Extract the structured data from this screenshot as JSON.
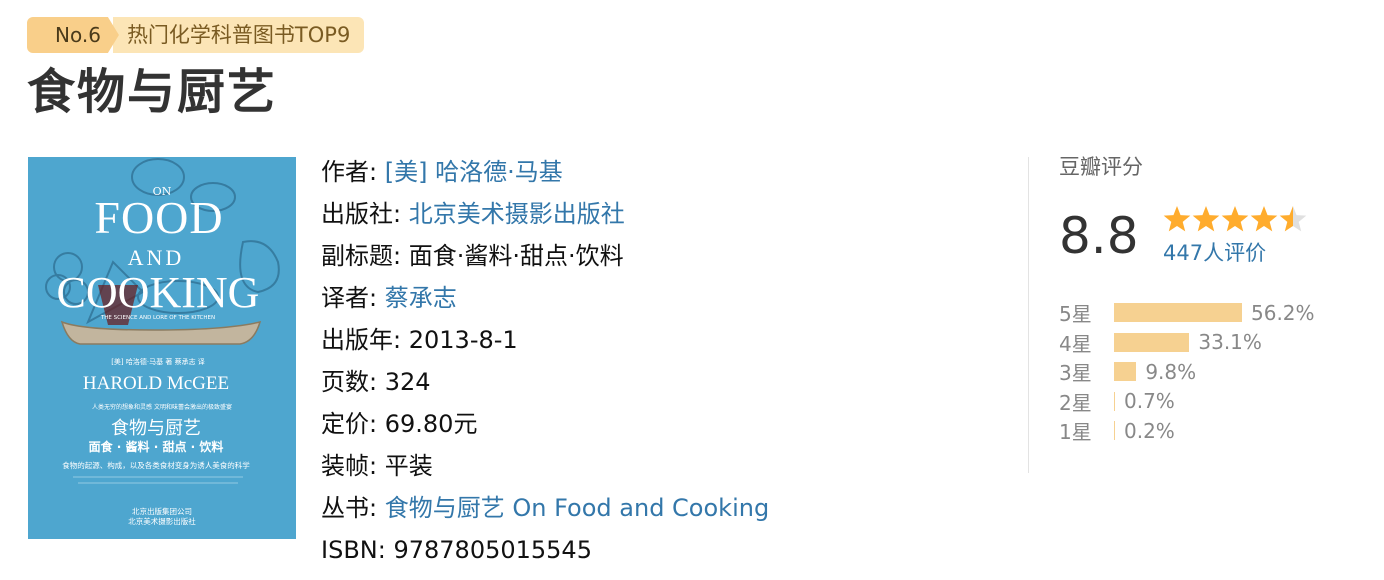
{
  "badge": {
    "rank": "No.6",
    "list": "热门化学科普图书TOP9"
  },
  "title": "食物与厨艺",
  "cover": {
    "on": "ON",
    "food": "FOOD",
    "and": "AND",
    "cooking": "COOKING",
    "tagline": "THE SCIENCE AND LORE OF THE KITCHEN",
    "translator_line": "[美] 哈洛德·马基 著 蔡承志 译",
    "author_en": "HAROLD McGEE",
    "blurb": "人类无穷的想象和灵感 文明和味蕾会激出的极致盛宴",
    "title_cn": "食物与厨艺",
    "subtitle_cn": "面食 · 酱料 · 甜点 · 饮料",
    "desc": "食物的起源、构成，以及各类食材变身为诱人美食的科学",
    "publisher1": "北京出版集团公司",
    "publisher2": "北京美术摄影出版社"
  },
  "info": [
    {
      "key": "作者:",
      "value": "[美] 哈洛德·马基",
      "link": true
    },
    {
      "key": "出版社:",
      "value": "北京美术摄影出版社",
      "link": true
    },
    {
      "key": "副标题:",
      "value": "面食·酱料·甜点·饮料",
      "link": false
    },
    {
      "key": "译者:",
      "value": "蔡承志",
      "link": true
    },
    {
      "key": "出版年:",
      "value": "2013-8-1",
      "link": false
    },
    {
      "key": "页数:",
      "value": "324",
      "link": false
    },
    {
      "key": "定价:",
      "value": "69.80元",
      "link": false
    },
    {
      "key": "装帧:",
      "value": "平装",
      "link": false
    },
    {
      "key": "丛书:",
      "value": "食物与厨艺 On Food and Cooking",
      "link": true
    },
    {
      "key": "ISBN:",
      "value": "9787805015545",
      "link": false
    }
  ],
  "rating": {
    "title": "豆瓣评分",
    "score": "8.8",
    "stars": 4.5,
    "votes": "447人评价",
    "distribution": [
      {
        "label": "5星",
        "pct": "56.2%",
        "value": 56.2
      },
      {
        "label": "4星",
        "pct": "33.1%",
        "value": 33.1
      },
      {
        "label": "3星",
        "pct": "9.8%",
        "value": 9.8
      },
      {
        "label": "2星",
        "pct": "0.7%",
        "value": 0.7
      },
      {
        "label": "1星",
        "pct": "0.2%",
        "value": 0.2
      }
    ]
  },
  "colors": {
    "link": "#3377aa",
    "star": "#ffac2d",
    "bar": "#f6d191",
    "badge": "#f9cf8a"
  }
}
